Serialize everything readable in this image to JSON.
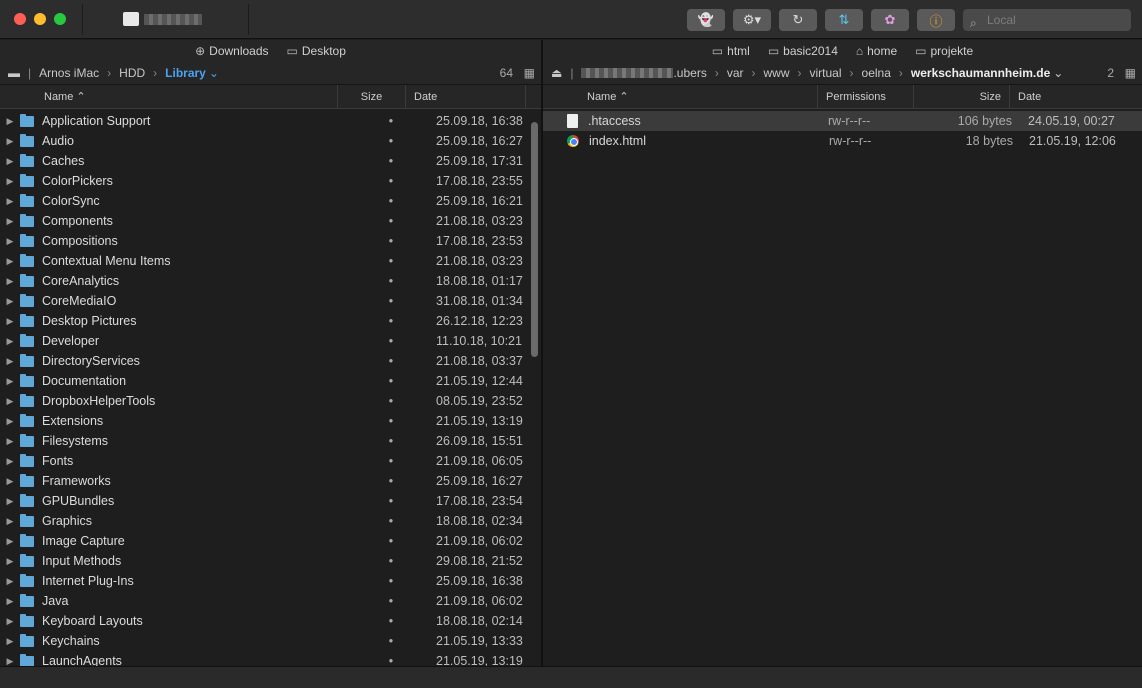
{
  "toolbar": {
    "search_placeholder": "Local",
    "buttons": [
      "ghost",
      "settings",
      "refresh",
      "sync",
      "pinwheel",
      "info"
    ]
  },
  "left": {
    "favorites": [
      {
        "icon": "download-icon",
        "label": "Downloads"
      },
      {
        "icon": "desktop-icon",
        "label": "Desktop"
      }
    ],
    "path": [
      "Arnos iMac",
      "HDD",
      "Library"
    ],
    "count": "64",
    "columns": {
      "name": "Name",
      "size": "Size",
      "date": "Date"
    },
    "rows": [
      [
        "Application Support",
        "25.09.18, 16:38"
      ],
      [
        "Audio",
        "25.09.18, 16:27"
      ],
      [
        "Caches",
        "25.09.18, 17:31"
      ],
      [
        "ColorPickers",
        "17.08.18, 23:55"
      ],
      [
        "ColorSync",
        "25.09.18, 16:21"
      ],
      [
        "Components",
        "21.08.18, 03:23"
      ],
      [
        "Compositions",
        "17.08.18, 23:53"
      ],
      [
        "Contextual Menu Items",
        "21.08.18, 03:23"
      ],
      [
        "CoreAnalytics",
        "18.08.18, 01:17"
      ],
      [
        "CoreMediaIO",
        "31.08.18, 01:34"
      ],
      [
        "Desktop Pictures",
        "26.12.18, 12:23"
      ],
      [
        "Developer",
        "11.10.18, 10:21"
      ],
      [
        "DirectoryServices",
        "21.08.18, 03:37"
      ],
      [
        "Documentation",
        "21.05.19, 12:44"
      ],
      [
        "DropboxHelperTools",
        "08.05.19, 23:52"
      ],
      [
        "Extensions",
        "21.05.19, 13:19"
      ],
      [
        "Filesystems",
        "26.09.18, 15:51"
      ],
      [
        "Fonts",
        "21.09.18, 06:05"
      ],
      [
        "Frameworks",
        "25.09.18, 16:27"
      ],
      [
        "GPUBundles",
        "17.08.18, 23:54"
      ],
      [
        "Graphics",
        "18.08.18, 02:34"
      ],
      [
        "Image Capture",
        "21.09.18, 06:02"
      ],
      [
        "Input Methods",
        "29.08.18, 21:52"
      ],
      [
        "Internet Plug-Ins",
        "25.09.18, 16:38"
      ],
      [
        "Java",
        "21.09.18, 06:02"
      ],
      [
        "Keyboard Layouts",
        "18.08.18, 02:14"
      ],
      [
        "Keychains",
        "21.05.19, 13:33"
      ],
      [
        "LaunchAgents",
        "21.05.19, 13:19"
      ]
    ]
  },
  "right": {
    "favorites": [
      {
        "icon": "folder-icon",
        "label": "html"
      },
      {
        "icon": "folder-icon",
        "label": "basic2014"
      },
      {
        "icon": "home-icon",
        "label": "home"
      },
      {
        "icon": "folder-icon",
        "label": "projekte"
      }
    ],
    "path": [
      ".ubers",
      "var",
      "www",
      "virtual",
      "oelna",
      "werkschaumannheim.de"
    ],
    "count": "2",
    "columns": {
      "name": "Name",
      "permissions": "Permissions",
      "size": "Size",
      "date": "Date"
    },
    "rows": [
      {
        "name": ".htaccess",
        "perm": "rw-r--r--",
        "size": "106 bytes",
        "date": "24.05.19, 00:27",
        "icon": "file"
      },
      {
        "name": "index.html",
        "perm": "rw-r--r--",
        "size": "18 bytes",
        "date": "21.05.19, 12:06",
        "icon": "chrome"
      }
    ]
  }
}
